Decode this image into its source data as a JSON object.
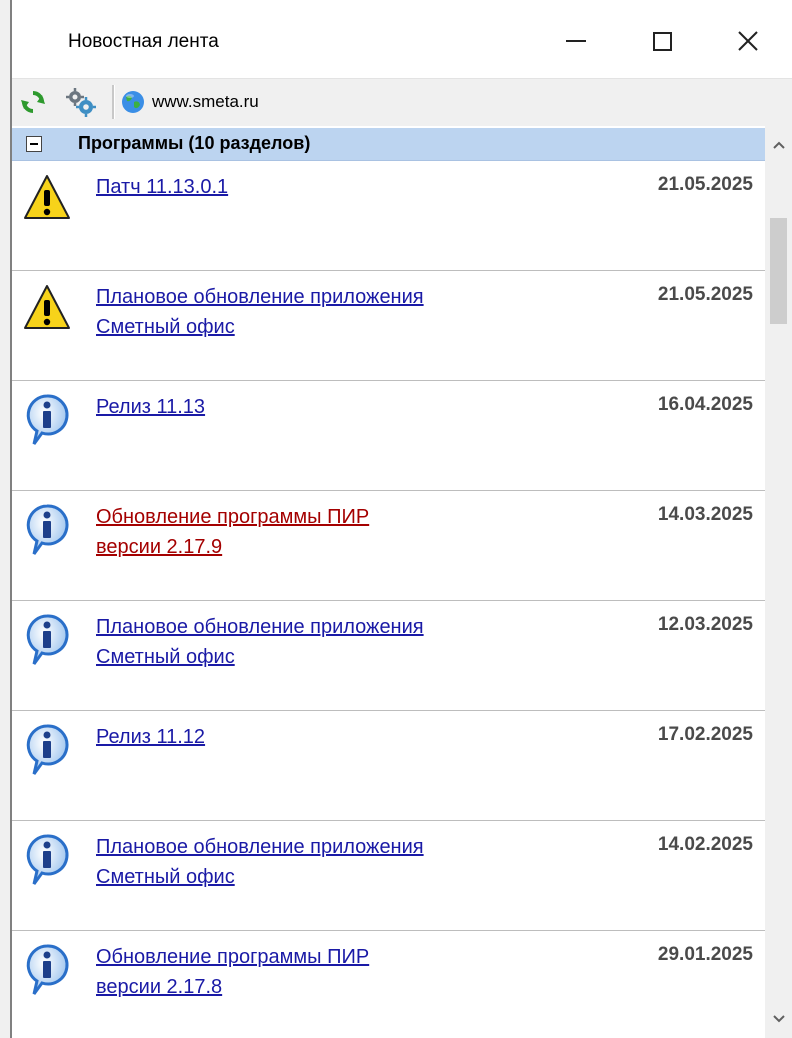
{
  "window": {
    "title": "Новостная лента",
    "minimize_label": "Свернуть",
    "maximize_label": "Развернуть",
    "close_label": "Закрыть"
  },
  "toolbar": {
    "refresh_icon": "refresh-icon",
    "settings_icon": "gears-icon",
    "site_icon": "globe-icon",
    "site_label": "www.smeta.ru"
  },
  "group": {
    "title": "Программы (10 разделов)",
    "header_color": "#bcd4f0"
  },
  "items": [
    {
      "icon": "warning",
      "title": "Патч 11.13.0.1",
      "date": "21.05.2025",
      "visited": false
    },
    {
      "icon": "warning",
      "title": "Плановое обновление приложения\nСметный офис",
      "date": "21.05.2025",
      "visited": false
    },
    {
      "icon": "info",
      "title": "Релиз 11.13",
      "date": "16.04.2025",
      "visited": false
    },
    {
      "icon": "info",
      "title": "Обновление программы ПИР\nверсии 2.17.9",
      "date": "14.03.2025",
      "visited": true
    },
    {
      "icon": "info",
      "title": "Плановое обновление приложения\nСметный офис",
      "date": "12.03.2025",
      "visited": false
    },
    {
      "icon": "info",
      "title": "Релиз 11.12",
      "date": "17.02.2025",
      "visited": false
    },
    {
      "icon": "info",
      "title": "Плановое обновление приложения\nСметный офис",
      "date": "14.02.2025",
      "visited": false
    },
    {
      "icon": "info",
      "title": "Обновление программы ПИР\nверсии 2.17.8",
      "date": "29.01.2025",
      "visited": false
    }
  ],
  "colors": {
    "link": "#1a1aa6",
    "visited_link": "#a40000",
    "date": "#4a4a4a",
    "warning_yellow": "#f7d31a",
    "info_blue": "#2a6fc9"
  }
}
